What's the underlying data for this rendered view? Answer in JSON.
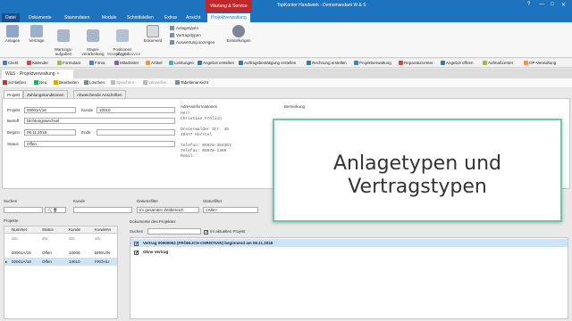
{
  "window": {
    "title": "TopKontor Handwerk - Demomandant W & S",
    "context_tab": "Wartung & Service",
    "controls": [
      "?",
      "—",
      "□",
      "✕"
    ]
  },
  "ribbon_tabs": [
    "Datei",
    "Dokumente",
    "Stammdaten",
    "Module",
    "Schnittstellen",
    "Extras",
    "Ansicht",
    "Projektverwaltung"
  ],
  "ribbon": {
    "buttons": [
      "Anlagen",
      "Verträge",
      "Wartungs-\naufgaben",
      "Stapel-\nverarbeitung",
      "Positionen\npflegen",
      "Dokument",
      "Einstellungen"
    ],
    "small_items": [
      "Anlagetypen",
      "Vertragstypen",
      "Auswertung anzeigen"
    ],
    "group_label": "Wartung & Service"
  },
  "quickbar": [
    "Client",
    "Kalender",
    "Formulare",
    "Firma",
    "Mitarbeiter",
    "Artikel",
    "Leistungen",
    "Angebot erstellen",
    "Auftragsbestätigung erstellen",
    "Rechnung erstellen",
    "Projektverwaltung",
    "Reparaturcenter",
    "Angebot öffnen",
    "Aufmaßcenter",
    "OP-Verwaltung"
  ],
  "doc_tab": "W&S - Projektverwaltung",
  "toolbar": {
    "close": "Schließen",
    "new": "Neu",
    "edit": "Bearbeiten",
    "delete": "Löschen",
    "save": "Speichern",
    "discard": "Verwerfen",
    "table_view": "Tabellenansicht"
  },
  "subtabs": [
    "Projekt",
    "Zahlungskonditionen",
    "Abweichende Anschriften"
  ],
  "form": {
    "projekt_label": "Projekt",
    "projekt_value": "00001A/18",
    "kunde_label": "Kunde",
    "kunde_value": "10010",
    "betreff_label": "Betreff",
    "betreff_value": "Dichtungswechsel",
    "beginn_label": "Beginn",
    "beginn_value": "06.11.2018",
    "ende_label": "Ende",
    "status_label": "Status",
    "status_value": "Offen",
    "adresse_label": "Adressinformationen",
    "adresse_lines": "Herr\nChristian Frölich\n\nDreierwalder Str. 45\n48477 Hörstel\n\nTelefon: 05978-354367\nTelefax: 05978-1305\nMobil:",
    "bemerkung_label": "Bemerkung"
  },
  "filters": {
    "suchen_label": "Suchen",
    "kunde_label": "Kunde",
    "datum_label": "Datumsfilter",
    "datum_value": "Im gesamten Zeitbereich",
    "status_label": "Statusfilter",
    "status_value": "<Alle>"
  },
  "projects_panel": {
    "title": "Projekte",
    "columns": [
      "Nummer",
      "Status",
      "Kunde",
      "Kundenn"
    ],
    "filter_row": [
      "abc",
      "abc",
      "abc",
      "abc"
    ],
    "rows": [
      [
        "00001A/15",
        "Offen",
        "10009",
        "BREUIN"
      ],
      [
        "00001A/18",
        "Offen",
        "10010",
        "FRÖHLI"
      ]
    ]
  },
  "docs_panel": {
    "title": "Dokumente des Projektes",
    "search_label": "Suchen",
    "current_project_label": "Im aktuellen Projekt",
    "items": [
      "Vertrag 00000002 (FRÖHLICH CHRISTIAN) beginnend am 06.11.2018",
      "Ohne Vertrag"
    ]
  },
  "overlay": {
    "line1": "Anlagetypen und",
    "line2": "Vertragstypen",
    "border_color": "#6fc7a8"
  },
  "colors": {
    "accent": "#1e73be",
    "context": "#c1282b",
    "selection": "#cfe3f7"
  }
}
